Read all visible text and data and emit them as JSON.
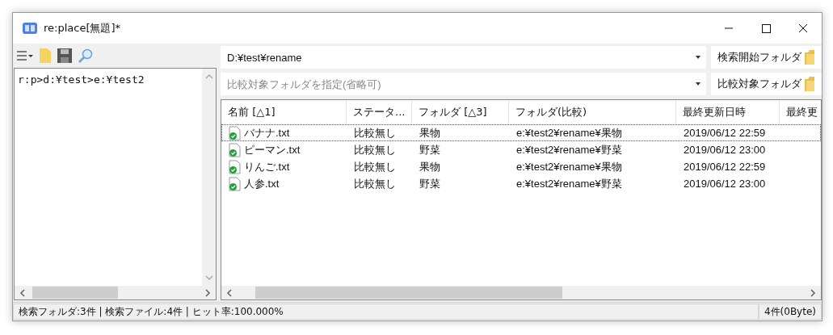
{
  "window": {
    "title": "re:place[無題]*"
  },
  "script": {
    "value": "r:p>d:¥test>e:¥test2"
  },
  "search_folder": {
    "value": "D:¥test¥rename",
    "button": "検索開始フォルダ"
  },
  "compare_folder": {
    "placeholder": "比較対象フォルダを指定(省略可)",
    "button": "比較対象フォルダ"
  },
  "table": {
    "columns": [
      "名前 [△1]",
      "ステータ...",
      "フォルダ [△3]",
      "フォルダ(比較)",
      "最終更新日時",
      "最終更"
    ],
    "rows": [
      {
        "selected": true,
        "cells": [
          "バナナ.txt",
          "比較無し",
          "果物",
          "e:¥test2¥rename¥果物",
          "2019/06/12 22:59"
        ]
      },
      {
        "selected": false,
        "cells": [
          "ピーマン.txt",
          "比較無し",
          "野菜",
          "e:¥test2¥rename¥野菜",
          "2019/06/12 23:00"
        ]
      },
      {
        "selected": false,
        "cells": [
          "りんご.txt",
          "比較無し",
          "果物",
          "e:¥test2¥rename¥果物",
          "2019/06/12 22:59"
        ]
      },
      {
        "selected": false,
        "cells": [
          "人参.txt",
          "比較無し",
          "野菜",
          "e:¥test2¥rename¥野菜",
          "2019/06/12 23:00"
        ]
      }
    ]
  },
  "status_bar": {
    "left": "検索フォルダ:3件 | 検索ファイル:4件 | ヒット率:100.000%",
    "right": "4件(0Byte)"
  }
}
